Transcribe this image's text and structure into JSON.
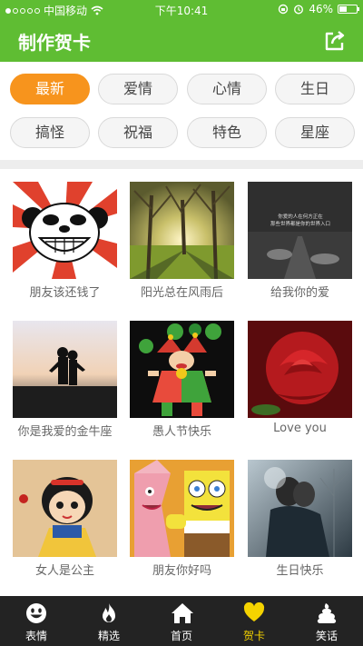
{
  "status_bar": {
    "carrier": "中国移动",
    "time": "下午10:41",
    "battery": "46%",
    "battery_level": 0.46
  },
  "header": {
    "title": "制作贺卡"
  },
  "categories": [
    {
      "label": "最新",
      "active": true
    },
    {
      "label": "爱情",
      "active": false
    },
    {
      "label": "心情",
      "active": false
    },
    {
      "label": "生日",
      "active": false
    },
    {
      "label": "搞怪",
      "active": false
    },
    {
      "label": "祝福",
      "active": false
    },
    {
      "label": "特色",
      "active": false
    },
    {
      "label": "星座",
      "active": false
    }
  ],
  "cards": [
    {
      "caption": "朋友该还钱了"
    },
    {
      "caption": "阳光总在风雨后"
    },
    {
      "caption": "给我你的爱",
      "image_text_1": "你爱的人在何方正在",
      "image_text_2": "那些世界都是你的世界入口"
    },
    {
      "caption": "你是我爱的金牛座"
    },
    {
      "caption": "愚人节快乐"
    },
    {
      "caption": "Love you"
    },
    {
      "caption": "女人是公主"
    },
    {
      "caption": "朋友你好吗"
    },
    {
      "caption": "生日快乐"
    }
  ],
  "tabbar": {
    "items": [
      {
        "label": "表情",
        "icon": "smiley-icon",
        "active": false
      },
      {
        "label": "精选",
        "icon": "flame-icon",
        "active": false
      },
      {
        "label": "首页",
        "icon": "home-icon",
        "active": false
      },
      {
        "label": "贺卡",
        "icon": "heart-icon",
        "active": true
      },
      {
        "label": "笑话",
        "icon": "poop-icon",
        "active": false
      }
    ]
  },
  "colors": {
    "brand_green": "#5fbd33",
    "active_chip": "#f7941d",
    "tab_active": "#f5d300",
    "tabbar_bg": "#232323"
  }
}
